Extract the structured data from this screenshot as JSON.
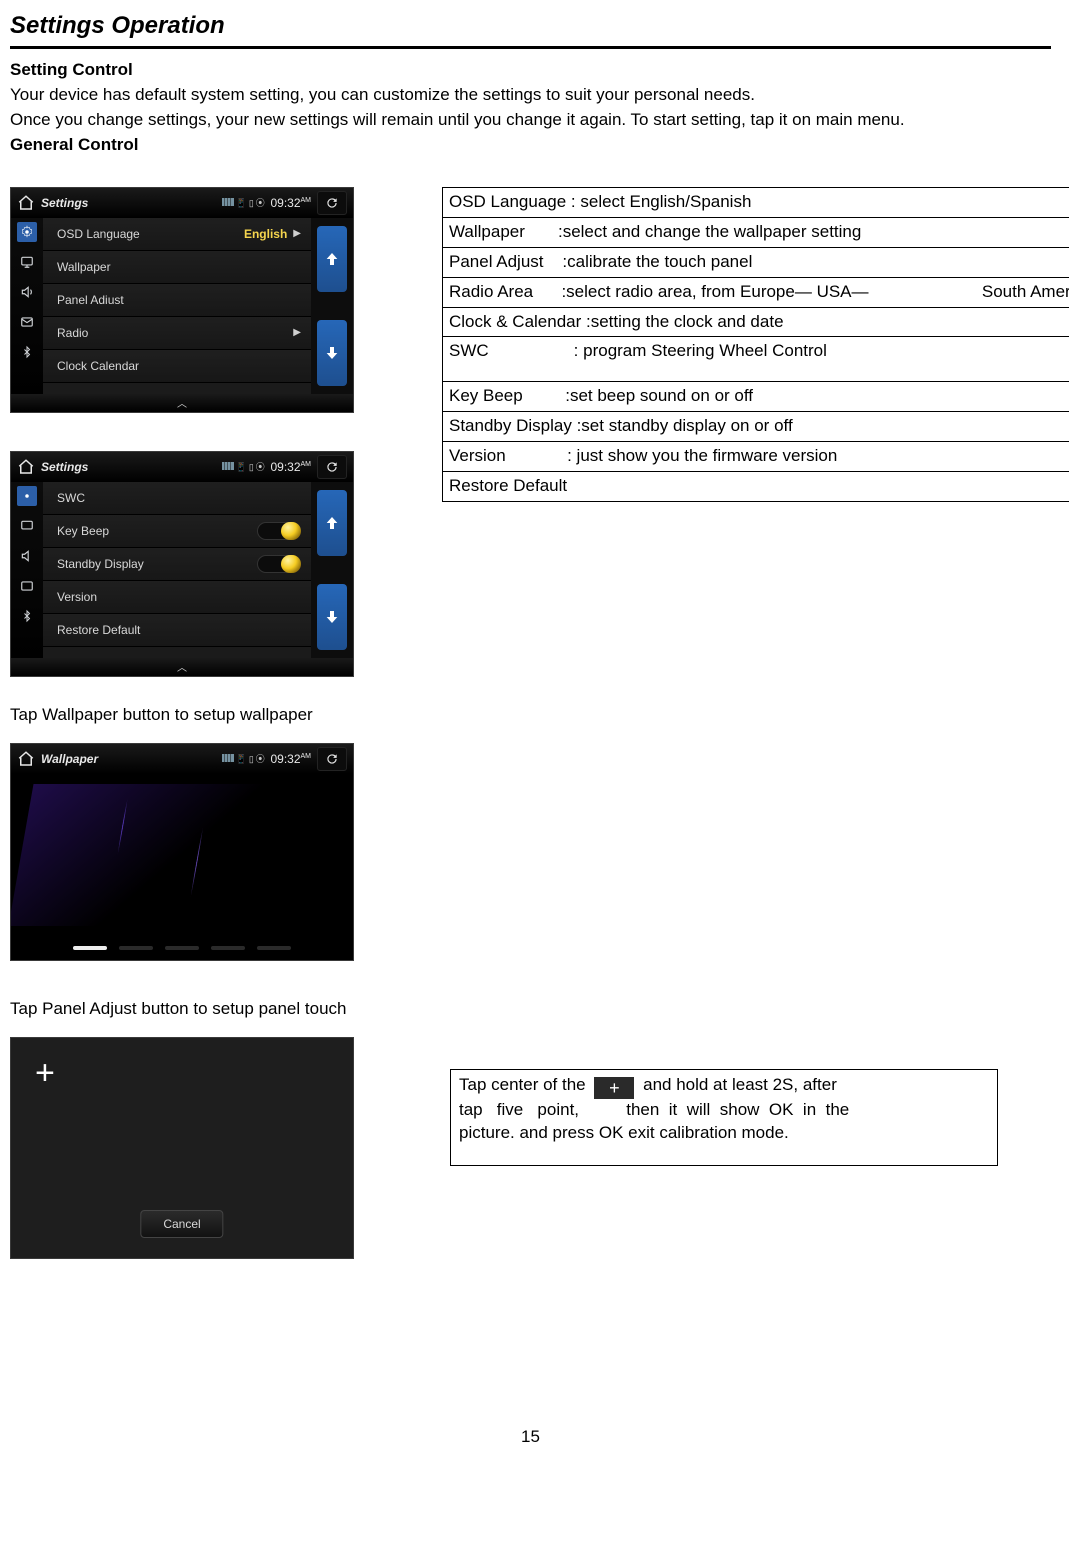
{
  "page": {
    "title": "Settings Operation",
    "number": "15"
  },
  "headings": {
    "setting_control": "Setting Control",
    "general_control": "General Control"
  },
  "intro": {
    "line1": "Your device has default system setting, you can customize the settings to suit your personal needs.",
    "line2": "Once you change settings, your new settings will remain until you change it again. To start setting, tap it on main menu."
  },
  "captions": {
    "wallpaper": "Tap Wallpaper button to setup wallpaper",
    "panel_adjust": "Tap Panel Adjust button to setup panel touch"
  },
  "desc_table": {
    "r0": "OSD Language : select English/Spanish",
    "r1": "Wallpaper       :select and change the wallpaper setting",
    "r2": "Panel Adjust    :calibrate the touch panel",
    "r3": "Radio Area      :select radio area, from Europe— USA—                        South America—Russian— Asia",
    "r4": "Clock & Calendar :setting the clock and date",
    "r5": "SWC                  : program Steering Wheel Control",
    "r6": "Key Beep         :set beep sound on or off",
    "r7": "Standby Display :set standby display on or off",
    "r8": "Version             : just show you the firmware version",
    "r9": "Restore Default"
  },
  "tipbox": {
    "line_a_pre": "Tap center of the",
    "line_a_post": "and hold at least 2S, after",
    "line_b": "tap   five   point,          then  it  will  show  OK  in  the",
    "line_c": "picture. and press OK exit calibration mode."
  },
  "shots": {
    "common": {
      "title_settings": "Settings",
      "title_wallpaper": "Wallpaper",
      "clock": "09:32",
      "ampm": "AM"
    },
    "list1": {
      "i0": "OSD Language",
      "i0v": "English",
      "i1": "Wallpaper",
      "i2": "Panel Adiust",
      "i3": "Radio",
      "i4": "Clock Calendar"
    },
    "list2": {
      "i0": "SWC",
      "i1": "Key Beep",
      "i2": "Standby Display",
      "i3": "Version",
      "i4": "Restore Default"
    },
    "panel": {
      "cancel": "Cancel"
    }
  }
}
